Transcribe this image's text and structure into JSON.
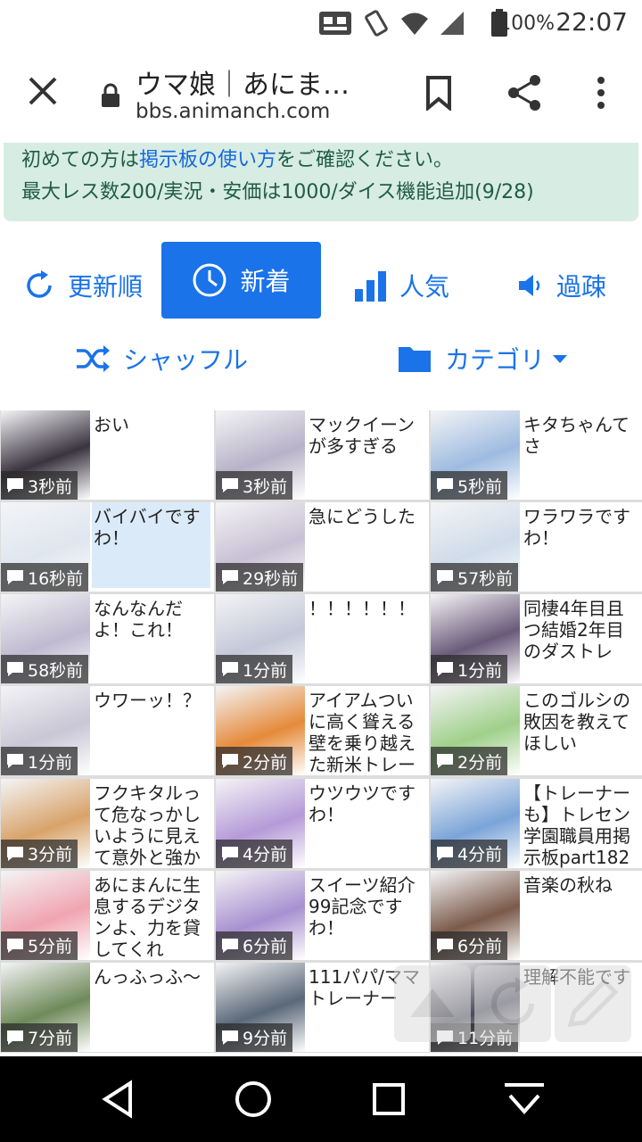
{
  "status_bar": {
    "battery": "100%",
    "time": "22:07"
  },
  "browser": {
    "page_title": "ウマ娘｜あにま…",
    "url": "bbs.animanch.com"
  },
  "notice": {
    "line1_prefix": "初めての方は",
    "line1_link": "掲示板の使い方",
    "line1_suffix": "をご確認ください。",
    "line2": "最大レス数200/実況・安価は1000/ダイス機能追加(9/28)"
  },
  "nav": {
    "sort_update": "更新順",
    "sort_new": "新着",
    "sort_popular": "人気",
    "sort_old": "過疎",
    "shuffle": "シャッフル",
    "category": "カテゴリ"
  },
  "threads": [
    {
      "title": "おい",
      "time": "3秒前",
      "color": "#3a3440"
    },
    {
      "title": "マックイーンが多すぎる",
      "time": "3秒前",
      "color": "#b7b2c8"
    },
    {
      "title": "キタちゃんてさ",
      "time": "5秒前",
      "color": "#9dbbe0"
    },
    {
      "title": "バイバイですわ！",
      "time": "16秒前",
      "color": "#dfe6ef"
    },
    {
      "title": "急にどうした",
      "time": "29秒前",
      "color": "#c8c0d4"
    },
    {
      "title": "ワラワラですわ！",
      "time": "57秒前",
      "color": "#cfdcea"
    },
    {
      "title": "なんなんだよ！これ！",
      "time": "58秒前",
      "color": "#bfbad0"
    },
    {
      "title": "！！！！！！",
      "time": "1分前",
      "color": "#c4c7d8"
    },
    {
      "title": "同棲4年目且つ結婚2年目のダストレ",
      "time": "1分前",
      "color": "#6a5a7a"
    },
    {
      "title": "ウワーッ！？",
      "time": "1分前",
      "color": "#c9c6d6"
    },
    {
      "title": "アイアムついに高く聳える壁を乗り越えた新米トレー",
      "time": "2分前",
      "color": "#e58a3a"
    },
    {
      "title": "このゴルシの敗因を教えてほしい",
      "time": "2分前",
      "color": "#9fd08a"
    },
    {
      "title": "フクキタルって危なっかしいように見えて意外と強か",
      "time": "3分前",
      "color": "#d8a36a"
    },
    {
      "title": "ウツウツですわ！",
      "time": "4分前",
      "color": "#b59ad8"
    },
    {
      "title": "【トレーナーも】トレセン学園職員用掲示板part182",
      "time": "4分前",
      "color": "#7aa4d8"
    },
    {
      "title": "あにまんに生息するデジタンよ、力を貸してくれ",
      "time": "5分前",
      "color": "#f0a5b0"
    },
    {
      "title": "スイーツ紹介99記念ですわ！",
      "time": "6分前",
      "color": "#a890d0"
    },
    {
      "title": "音楽の秋ね",
      "time": "6分前",
      "color": "#7a5a4a"
    },
    {
      "title": "んっふっふ〜",
      "time": "7分前",
      "color": "#6f8a5a"
    },
    {
      "title": "111パパ/ママトレーナー",
      "time": "9分前",
      "color": "#5a6878"
    },
    {
      "title": "理解不能です",
      "time": "11分前",
      "color": "#4a4a5a"
    }
  ]
}
